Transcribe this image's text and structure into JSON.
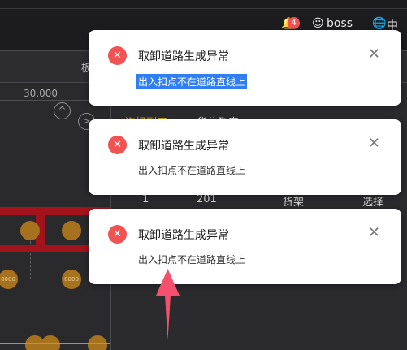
{
  "header": {
    "notification_count": "4",
    "user_name": "boss",
    "language": "中文",
    "partial_label": "板"
  },
  "map": {
    "coordinate": "30,000",
    "btn_up": "^",
    "btn_right": ">",
    "node_label": "8000"
  },
  "panel": {
    "tabs": [
      "选择列表",
      "货位列表"
    ],
    "row": [
      "1",
      "201",
      "货架",
      "选择"
    ]
  },
  "toasts": [
    {
      "title": "取卸道路生成异常",
      "message": "出入扣点不在道路直线上",
      "selected": true
    },
    {
      "title": "取卸道路生成异常",
      "message": "出入扣点不在道路直线上",
      "selected": false
    },
    {
      "title": "取卸道路生成异常",
      "message": "出入扣点不在道路直线上",
      "selected": false
    }
  ],
  "colors": {
    "accent": "#e0a31a",
    "error": "#f15252",
    "highlight": "#2f7ff2",
    "annotation_arrow": "#f44f6c"
  },
  "icons": {
    "error": "error-circle-icon",
    "close": "close-icon",
    "bell": "bell-icon",
    "user": "user-icon",
    "globe": "globe-icon"
  }
}
